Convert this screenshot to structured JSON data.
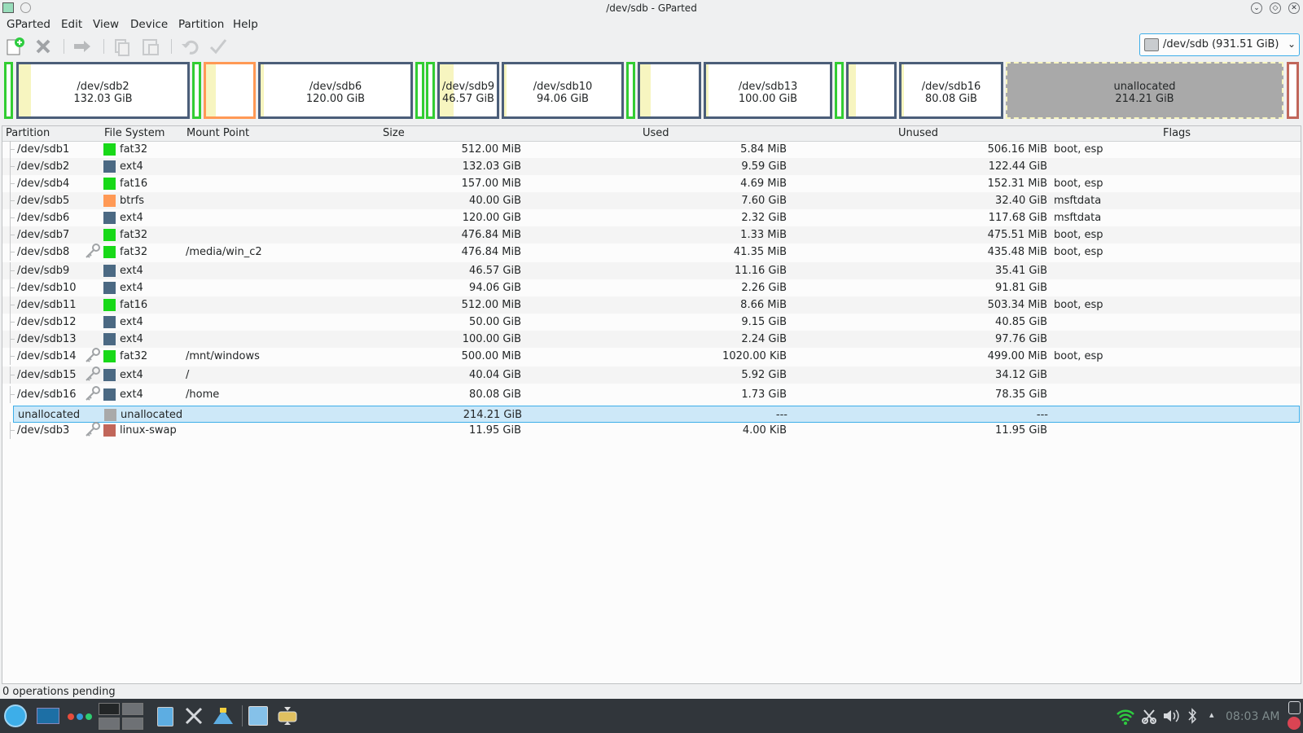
{
  "window": {
    "title": "/dev/sdb - GParted"
  },
  "menu": [
    "GParted",
    "Edit",
    "View",
    "Device",
    "Partition",
    "Help"
  ],
  "toolbar": {
    "icons": [
      "new-partition-icon",
      "delete-icon",
      "resize-move-icon",
      "copy-icon",
      "paste-icon",
      "undo-icon",
      "apply-icon"
    ]
  },
  "device_selector": {
    "value": "/dev/sdb   (931.51 GiB)"
  },
  "disk_map": [
    {
      "name": "",
      "size": "",
      "color": "#32cd32"
    },
    {
      "name": "/dev/sdb2",
      "size": "132.03 GiB",
      "color": "#4b5e79",
      "used": 0.07
    },
    {
      "name": "",
      "size": "",
      "color": "#32cd32"
    },
    {
      "name": "",
      "size": "",
      "color": "#ff9955",
      "used": 0.19
    },
    {
      "name": "/dev/sdb6",
      "size": "120.00 GiB",
      "color": "#4b5e79",
      "used": 0.02
    },
    {
      "name": "",
      "size": "",
      "color": "#32cd32"
    },
    {
      "name": "",
      "size": "",
      "color": "#32cd32"
    },
    {
      "name": "/dev/sdb9",
      "size": "46.57 GiB",
      "color": "#4b5e79",
      "used": 0.24
    },
    {
      "name": "/dev/sdb10",
      "size": "94.06 GiB",
      "color": "#4b5e79",
      "used": 0.02
    },
    {
      "name": "",
      "size": "",
      "color": "#32cd32"
    },
    {
      "name": "",
      "size": "",
      "color": "#4b5e79",
      "used": 0.18
    },
    {
      "name": "/dev/sdb13",
      "size": "100.00 GiB",
      "color": "#4b5e79",
      "used": 0.02
    },
    {
      "name": "",
      "size": "",
      "color": "#32cd32"
    },
    {
      "name": "",
      "size": "",
      "color": "#4b5e79",
      "used": 0.15
    },
    {
      "name": "/dev/sdb16",
      "size": "80.08 GiB",
      "color": "#4b5e79",
      "used": 0.02
    },
    {
      "name": "unallocated",
      "size": "214.21 GiB",
      "color": "#a9a9a9"
    },
    {
      "name": "",
      "size": "",
      "color": "#c1665a"
    }
  ],
  "columns": [
    "Partition",
    "File System",
    "Mount Point",
    "Size",
    "Used",
    "Unused",
    "Flags"
  ],
  "partitions": [
    {
      "partition": "/dev/sdb1",
      "fs": "fat32",
      "color": "#18d918",
      "mount": "",
      "size": "512.00 MiB",
      "used": "5.84 MiB",
      "unused": "506.16 MiB",
      "flags": "boot, esp",
      "key": false
    },
    {
      "partition": "/dev/sdb2",
      "fs": "ext4",
      "color": "#4b6983",
      "mount": "",
      "size": "132.03 GiB",
      "used": "9.59 GiB",
      "unused": "122.44 GiB",
      "flags": "",
      "key": false
    },
    {
      "partition": "/dev/sdb4",
      "fs": "fat16",
      "color": "#18d918",
      "mount": "",
      "size": "157.00 MiB",
      "used": "4.69 MiB",
      "unused": "152.31 MiB",
      "flags": "boot, esp",
      "key": false
    },
    {
      "partition": "/dev/sdb5",
      "fs": "btrfs",
      "color": "#ff9955",
      "mount": "",
      "size": "40.00 GiB",
      "used": "7.60 GiB",
      "unused": "32.40 GiB",
      "flags": "msftdata",
      "key": false
    },
    {
      "partition": "/dev/sdb6",
      "fs": "ext4",
      "color": "#4b6983",
      "mount": "",
      "size": "120.00 GiB",
      "used": "2.32 GiB",
      "unused": "117.68 GiB",
      "flags": "msftdata",
      "key": false
    },
    {
      "partition": "/dev/sdb7",
      "fs": "fat32",
      "color": "#18d918",
      "mount": "",
      "size": "476.84 MiB",
      "used": "1.33 MiB",
      "unused": "475.51 MiB",
      "flags": "boot, esp",
      "key": false
    },
    {
      "partition": "/dev/sdb8",
      "fs": "fat32",
      "color": "#18d918",
      "mount": "/media/win_c2",
      "size": "476.84 MiB",
      "used": "41.35 MiB",
      "unused": "435.48 MiB",
      "flags": "boot, esp",
      "key": true
    },
    {
      "partition": "/dev/sdb9",
      "fs": "ext4",
      "color": "#4b6983",
      "mount": "",
      "size": "46.57 GiB",
      "used": "11.16 GiB",
      "unused": "35.41 GiB",
      "flags": "",
      "key": false
    },
    {
      "partition": "/dev/sdb10",
      "fs": "ext4",
      "color": "#4b6983",
      "mount": "",
      "size": "94.06 GiB",
      "used": "2.26 GiB",
      "unused": "91.81 GiB",
      "flags": "",
      "key": false
    },
    {
      "partition": "/dev/sdb11",
      "fs": "fat16",
      "color": "#18d918",
      "mount": "",
      "size": "512.00 MiB",
      "used": "8.66 MiB",
      "unused": "503.34 MiB",
      "flags": "boot, esp",
      "key": false
    },
    {
      "partition": "/dev/sdb12",
      "fs": "ext4",
      "color": "#4b6983",
      "mount": "",
      "size": "50.00 GiB",
      "used": "9.15 GiB",
      "unused": "40.85 GiB",
      "flags": "",
      "key": false
    },
    {
      "partition": "/dev/sdb13",
      "fs": "ext4",
      "color": "#4b6983",
      "mount": "",
      "size": "100.00 GiB",
      "used": "2.24 GiB",
      "unused": "97.76 GiB",
      "flags": "",
      "key": false
    },
    {
      "partition": "/dev/sdb14",
      "fs": "fat32",
      "color": "#18d918",
      "mount": "/mnt/windows",
      "size": "500.00 MiB",
      "used": "1020.00 KiB",
      "unused": "499.00 MiB",
      "flags": "boot, esp",
      "key": true
    },
    {
      "partition": "/dev/sdb15",
      "fs": "ext4",
      "color": "#4b6983",
      "mount": "/",
      "size": "40.04 GiB",
      "used": "5.92 GiB",
      "unused": "34.12 GiB",
      "flags": "",
      "key": true
    },
    {
      "partition": "/dev/sdb16",
      "fs": "ext4",
      "color": "#4b6983",
      "mount": "/home",
      "size": "80.08 GiB",
      "used": "1.73 GiB",
      "unused": "78.35 GiB",
      "flags": "",
      "key": true
    },
    {
      "partition": "unallocated",
      "fs": "unallocated",
      "color": "#a9a9a9",
      "mount": "",
      "size": "214.21 GiB",
      "used": "---",
      "unused": "---",
      "flags": "",
      "key": false,
      "selected": true
    },
    {
      "partition": "/dev/sdb3",
      "fs": "linux-swap",
      "color": "#c1665a",
      "mount": "",
      "size": "11.95 GiB",
      "used": "4.00 KiB",
      "unused": "11.95 GiB",
      "flags": "",
      "key": true
    }
  ],
  "status": "0 operations pending",
  "taskbar": {
    "clock": "08:03 AM"
  }
}
